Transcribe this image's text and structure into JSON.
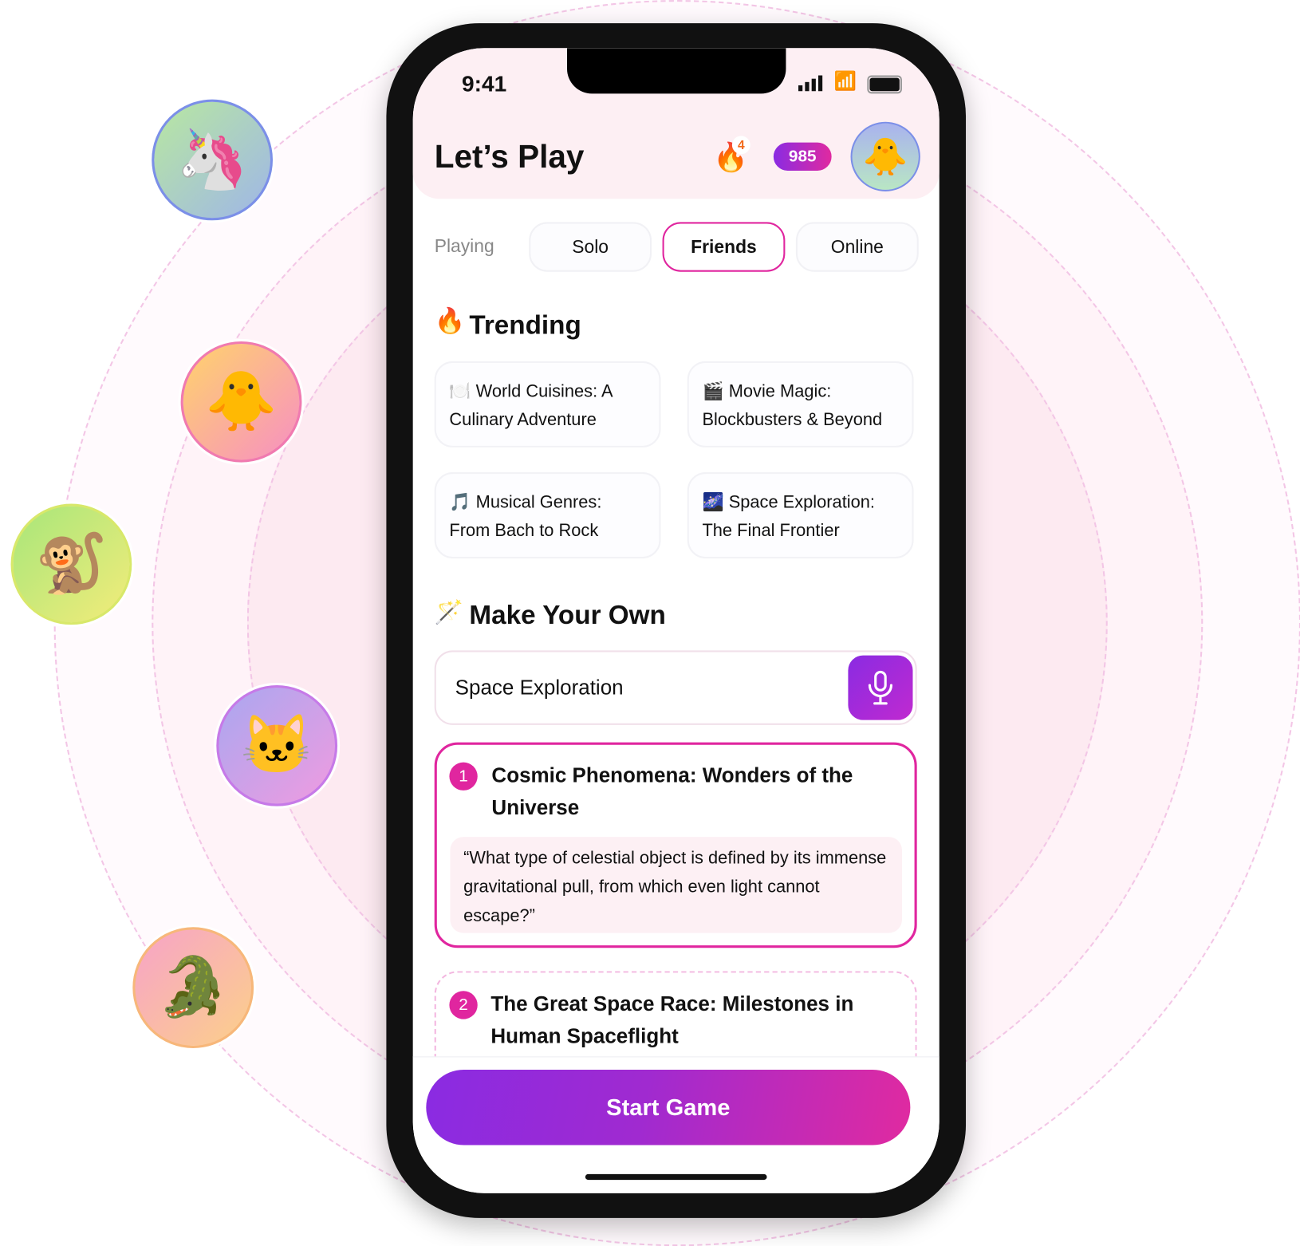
{
  "status_bar": {
    "time": "9:41"
  },
  "header": {
    "title": "Let’s Play",
    "streak_count": "4",
    "points": "985"
  },
  "tabs": {
    "label": "Playing",
    "items": [
      {
        "label": "Solo"
      },
      {
        "label": "Friends",
        "active": true
      },
      {
        "label": "Online"
      }
    ]
  },
  "trending": {
    "heading": "Trending",
    "icon": "fire-icon",
    "items": [
      {
        "icon": "🍽️",
        "title": "World Cuisines: A Culinary Adventure"
      },
      {
        "icon": "🎬",
        "title": "Movie Magic: Blockbusters & Beyond"
      },
      {
        "icon": "🎵",
        "title": "Musical Genres: From Bach to Rock"
      },
      {
        "icon": "🌌",
        "title": "Space Exploration: The Final Frontier"
      }
    ]
  },
  "make_own": {
    "heading": "Make Your Own",
    "icon": "magic-wand-icon",
    "input_value": "Space Exploration"
  },
  "suggestions": [
    {
      "number": "1",
      "title": "Cosmic Phenomena: Wonders of the Universe",
      "question": "“What type of celestial object is defined by its immense gravitational pull, from which even light cannot escape?”",
      "selected": true
    },
    {
      "number": "2",
      "title": "The Great Space Race: Milestones in Human Spaceflight"
    }
  ],
  "start_button": "Start Game",
  "avatars": [
    "unicorn",
    "chick",
    "monkey",
    "cat",
    "crocodile"
  ],
  "colors": {
    "accent": "#e0269f",
    "purple": "#8a2be2",
    "header_bg": "#fdeff3"
  }
}
